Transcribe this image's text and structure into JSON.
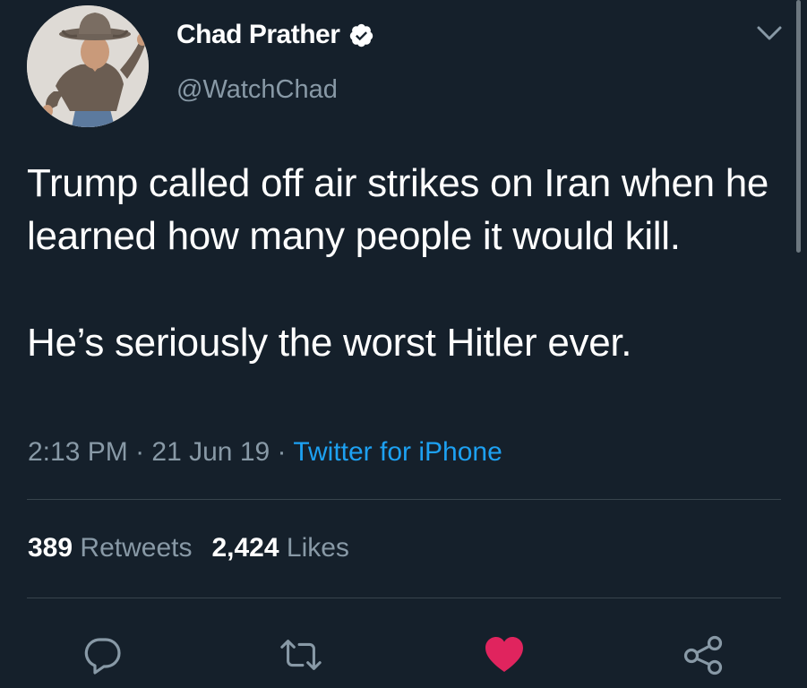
{
  "tweet": {
    "author": {
      "name": "Chad Prather",
      "handle": "@WatchChad",
      "verified": true
    },
    "paragraphs": [
      "Trump called off air strikes on Iran when he learned how many people it would kill.",
      "He’s seriously the worst Hitler ever."
    ],
    "time": "2:13 PM",
    "separator": " · ",
    "date": "21 Jun 19",
    "source": "Twitter for iPhone",
    "retweets_count": "389",
    "retweets_label": "Retweets",
    "likes_count": "2,424",
    "likes_label": "Likes",
    "liked": true
  },
  "actions": [
    {
      "name": "reply",
      "icon": "reply-icon"
    },
    {
      "name": "retweet",
      "icon": "retweet-icon"
    },
    {
      "name": "like",
      "icon": "heart-icon"
    },
    {
      "name": "share",
      "icon": "share-icon"
    }
  ],
  "colors": {
    "background": "#15202b",
    "secondary_text": "#8899a6",
    "link": "#1da1f2",
    "like": "#e0245e",
    "divider": "#38444d"
  }
}
